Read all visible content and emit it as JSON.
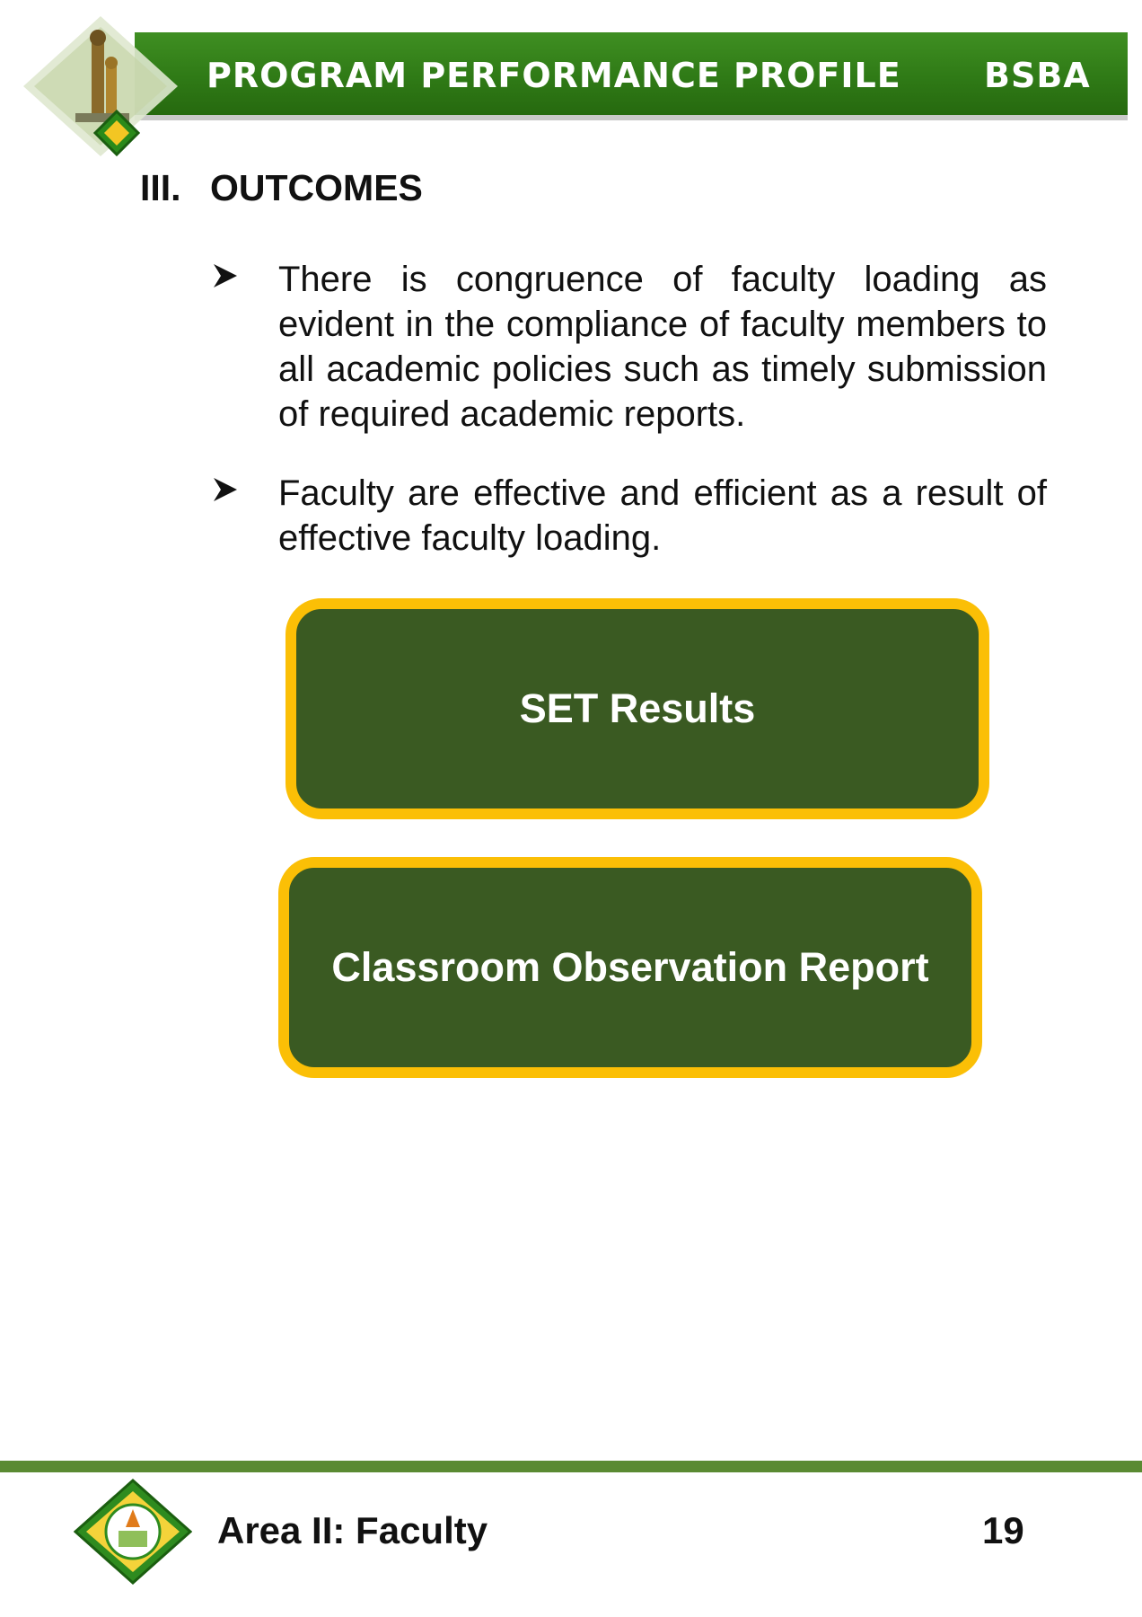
{
  "header": {
    "title": "PROGRAM PERFORMANCE PROFILE",
    "program_code": "BSBA"
  },
  "section": {
    "number": "III.",
    "title": "OUTCOMES"
  },
  "bullets": [
    {
      "text": "There is congruence of faculty loading as evident in the compliance of faculty members to all academic policies such as timely submission of required academic reports."
    },
    {
      "text": "Faculty are effective and efficient as a result of effective faculty loading."
    }
  ],
  "boxes": [
    {
      "label": "SET Results"
    },
    {
      "label": "Classroom Observation Report"
    }
  ],
  "footer": {
    "area": "Area II: Faculty",
    "page_number": "19"
  },
  "colors": {
    "header_green": "#2f7a16",
    "box_fill": "#3a5a22",
    "box_border": "#fbbf06",
    "footer_line": "#5a8a32"
  }
}
